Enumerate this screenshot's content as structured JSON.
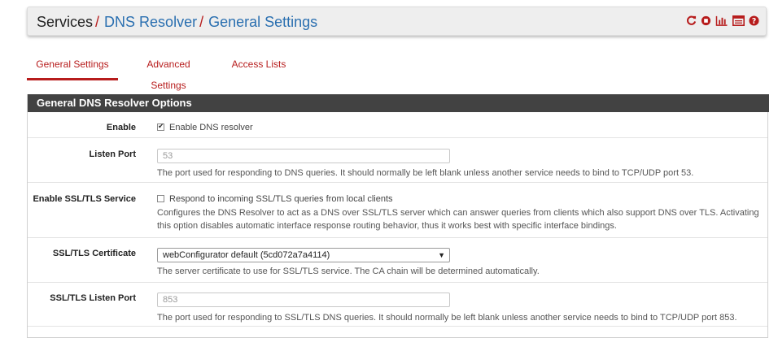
{
  "breadcrumb": {
    "root": "Services",
    "separator": "/",
    "items": [
      "DNS Resolver",
      "General Settings"
    ]
  },
  "header_icons": [
    "restart-icon",
    "stop-icon",
    "status-graph-icon",
    "log-icon",
    "help-icon"
  ],
  "colors": {
    "accent": "#b71c1c",
    "link": "#2a6fb0",
    "panel_heading": "#424242"
  },
  "tabs": [
    {
      "label": "General Settings",
      "active": true
    },
    {
      "label": "Advanced Settings",
      "active": false
    },
    {
      "label": "Access Lists",
      "active": false
    }
  ],
  "panel": {
    "title": "General DNS Resolver Options",
    "rows": [
      {
        "label": "Enable",
        "checkbox_label": "Enable DNS resolver",
        "checked": true
      },
      {
        "label": "Listen Port",
        "placeholder": "53",
        "help": "The port used for responding to DNS queries. It should normally be left blank unless another service needs to bind to TCP/UDP port 53."
      },
      {
        "label": "Enable SSL/TLS Service",
        "checkbox_label": "Respond to incoming SSL/TLS queries from local clients",
        "checked": false,
        "help_lines": [
          "Configures the DNS Resolver to act as a DNS over SSL/TLS server which can answer queries from clients which also support DNS over TLS. Activating",
          "this option disables automatic interface response routing behavior, thus it works best with specific interface bindings."
        ]
      },
      {
        "label": "SSL/TLS Certificate",
        "selected": "webConfigurator default (5cd072a7a4114)",
        "help": "The server certificate to use for SSL/TLS service. The CA chain will be determined automatically."
      },
      {
        "label": "SSL/TLS Listen Port",
        "placeholder": "853",
        "help": "The port used for responding to SSL/TLS DNS queries. It should normally be left blank unless another service needs to bind to TCP/UDP port 853."
      }
    ]
  }
}
